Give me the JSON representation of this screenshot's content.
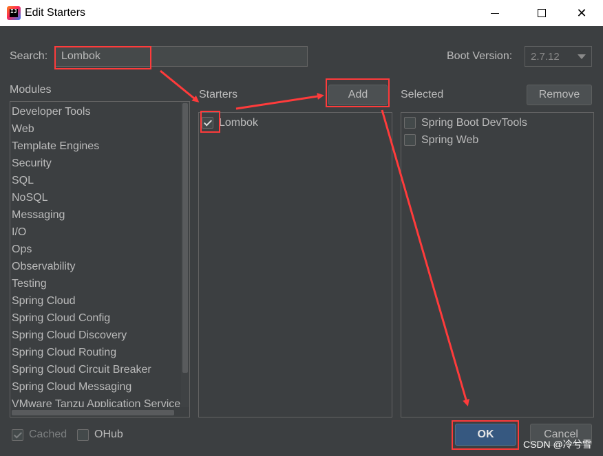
{
  "window": {
    "title": "Edit Starters",
    "app_icon_text": "IJ"
  },
  "search": {
    "label": "Search:",
    "value": "Lombok"
  },
  "boot_version": {
    "label": "Boot Version:",
    "value": "2.7.12"
  },
  "modules": {
    "label": "Modules",
    "items": [
      "Developer Tools",
      "Web",
      "Template Engines",
      "Security",
      "SQL",
      "NoSQL",
      "Messaging",
      "I/O",
      "Ops",
      "Observability",
      "Testing",
      "Spring Cloud",
      "Spring Cloud Config",
      "Spring Cloud Discovery",
      "Spring Cloud Routing",
      "Spring Cloud Circuit Breaker",
      "Spring Cloud Messaging",
      "VMware Tanzu Application Service"
    ]
  },
  "starters": {
    "label": "Starters",
    "add_label": "Add",
    "items": [
      {
        "label": "Lombok",
        "checked": true
      }
    ]
  },
  "selected": {
    "label": "Selected",
    "remove_label": "Remove",
    "items": [
      {
        "label": "Spring Boot DevTools",
        "checked": false
      },
      {
        "label": "Spring Web",
        "checked": false
      }
    ]
  },
  "footer": {
    "cached_label": "Cached",
    "cached_checked": true,
    "ohub_label": "OHub",
    "ohub_checked": false,
    "ok_label": "OK",
    "cancel_label": "Cancel"
  },
  "watermark": "CSDN @冷兮雪",
  "colors": {
    "background": "#3c3f41",
    "text": "#bbbbbb",
    "ok_button": "#365880",
    "annotation": "#ff3b3b"
  },
  "icons": {
    "app": "intellij-icon",
    "minimize": "minimize-icon",
    "maximize": "maximize-icon",
    "close": "close-icon",
    "dropdown": "chevron-down-icon",
    "check": "checkmark-icon"
  }
}
